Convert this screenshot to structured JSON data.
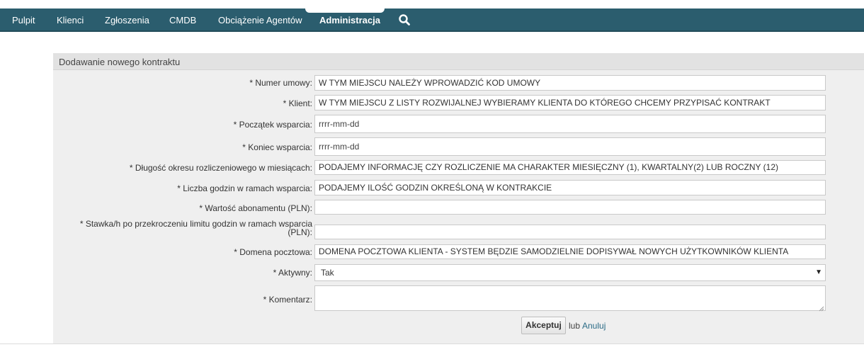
{
  "nav": {
    "items": [
      {
        "label": "Pulpit"
      },
      {
        "label": "Klienci"
      },
      {
        "label": "Zgłoszenia"
      },
      {
        "label": "CMDB"
      },
      {
        "label": "Obciążenie Agentów"
      },
      {
        "label": "Administracja",
        "active": true
      }
    ],
    "search_icon": "search-icon"
  },
  "panel": {
    "title": "Dodawanie nowego kontraktu"
  },
  "form": {
    "numer_umowy": {
      "label": "* Numer umowy:",
      "value": "W  TYM MIEJSCU NALEŻY WPROWADZIĆ KOD UMOWY"
    },
    "klient": {
      "label": "* Klient:",
      "value": "W TYM MIEJSCU Z LISTY ROZWIJALNEJ WYBIERAMY KLIENTA DO KTÓREGO CHCEMY PRZYPISAĆ KONTRAKT"
    },
    "poczatek": {
      "label": "* Początek wsparcia:",
      "placeholder": "rrrr-mm-dd"
    },
    "koniec": {
      "label": "* Koniec wsparcia:",
      "placeholder": "rrrr-mm-dd"
    },
    "dlugosc": {
      "label": "* Długość okresu rozliczeniowego w miesiącach:",
      "value": "PODAJEMY INFORMACJĘ CZY ROZLICZENIE MA CHARAKTER MIESIĘCZNY (1), KWARTALNY(2) LUB ROCZNY (12)"
    },
    "liczba_godzin": {
      "label": "* Liczba godzin w ramach wsparcia:",
      "value": "PODAJEMY ILOŚĆ GODZIN OKREŚLONĄ W KONTRAKCIE"
    },
    "wartosc": {
      "label": "* Wartość abonamentu (PLN):",
      "value": ""
    },
    "stawka": {
      "label": "* Stawka/h po przekroczeniu limitu godzin w ramach wsparcia (PLN):",
      "value": ""
    },
    "domena": {
      "label": "* Domena pocztowa:",
      "value": "DOMENA POCZTOWA KLIENTA - SYSTEM BĘDZIE SAMODZIELNIE DOPISYWAŁ NOWYCH UŻYTKOWNIKÓW KLIENTA"
    },
    "aktywny": {
      "label": "* Aktywny:",
      "value": "Tak"
    },
    "komentarz": {
      "label": "* Komentarz:",
      "value": ""
    }
  },
  "actions": {
    "accept_label": "Akceptuj",
    "or_label": "lub",
    "cancel_label": "Anuluj"
  },
  "colors": {
    "nav_bg": "#2b5d6e",
    "panel_bg": "#efefef",
    "link": "#2b6b86"
  }
}
